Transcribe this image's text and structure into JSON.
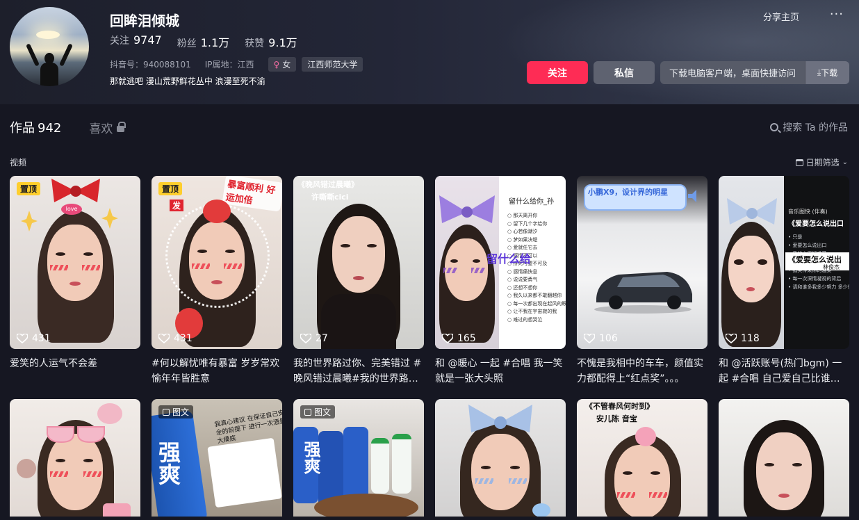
{
  "profile": {
    "name": "回眸泪倾城",
    "following_label": "关注",
    "following_value": "9747",
    "followers_label": "粉丝",
    "followers_value": "1.1万",
    "likes_label": "获赞",
    "likes_value": "9.1万",
    "douyin_id": "抖音号：940088101",
    "ip_location": "IP属地：江西",
    "gender_tag": "女",
    "school_tag": "江西师范大学",
    "bio": "那就逃吧 漫山荒野鲜花丛中 浪漫至死不渝"
  },
  "header_actions": {
    "share": "分享主页",
    "more": "···",
    "follow": "关注",
    "message": "私信",
    "download_text": "下载电脑客户端，桌面快捷访问",
    "download_button": "下载"
  },
  "tabs": {
    "works_label": "作品",
    "works_count": "942",
    "likes_label": "喜欢"
  },
  "search": {
    "label": "搜索 Ta 的作品"
  },
  "section": {
    "label": "视频",
    "date_filter": "日期筛选"
  },
  "videos_row1": [
    {
      "badge": "置顶",
      "likes": "431",
      "caption": "爱笑的人运气不会差"
    },
    {
      "badge": "置顶",
      "likes": "431",
      "caption": "#何以解忧唯有暴富 岁岁常欢愉年年皆胜意"
    },
    {
      "badge": "",
      "likes": "27",
      "caption": "我的世界路过你、完美错过 #晚风错过晨曦#我的世界路过你"
    },
    {
      "badge": "",
      "likes": "165",
      "caption": "和 @暖心 一起 #合唱 我一笑就是一张大头照"
    },
    {
      "badge": "",
      "likes": "106",
      "caption": "不愧是我相中的车车，颜值实力都配得上“红点奖”。。。"
    },
    {
      "badge": "",
      "likes": "118",
      "caption": "和 @活跃账号(热门bgm) 一起 #合唱 自己爱自己比谁爱你都重要"
    }
  ],
  "videos_row2": [
    {
      "badge": ""
    },
    {
      "badge": "图文"
    },
    {
      "badge": "图文"
    },
    {
      "badge": ""
    },
    {
      "badge": ""
    },
    {
      "badge": ""
    }
  ],
  "thumb_text": {
    "t2_sticker": "暴富顺利 好运加倍",
    "t2_fa": "发",
    "t3_title": "《晚风错过晨曦》",
    "t3_author": "许嘶嘶cici",
    "t4_title": "留什么给你_孙",
    "t4_overlay": "留什么给",
    "t4_lines": [
      "那天离开你",
      "留下几个字给你",
      "心若像潮汐",
      "梦如果决堤",
      "爱就任它去",
      "感情不可以",
      "拼死可望不可及",
      "感情痛快息",
      "说说要勇气",
      "还想不想你",
      "我久以来都不敢翻越你",
      "每一次都出现在起风的眼",
      "让不我在宇宙寂的我",
      "难过的想哭泣"
    ],
    "t5_banner": "小鹏X9，设计界的明星",
    "t6_header": "音乐图快 (伴奏)",
    "t6_title": "《爱要怎么说出口",
    "t6_song": "《爱要怎么说出",
    "t6_singer": "林俊杰",
    "t6_lines": [
      "只是",
      "爱要怎么说出口",
      "我的心里好难受",
      "第一次握你的手",
      "指尖传来你的温柔",
      "每一次深情凝视的背后",
      "请和谁多我多少努力 多少伤"
    ],
    "r2_t2_text": "我真心建议 在保证自己安全的前提下 进行一次酒量大摸底",
    "r2_t2_can": "强爽",
    "r2_t3_can": "强爽",
    "r2_t5_title": "《不管春风何时到》",
    "r2_t5_author": "安儿陈 音宝"
  },
  "colors": {
    "background": "#161722",
    "accent_red": "#fe2c55",
    "pin_yellow": "#fece2d",
    "message_gray": "#5e6270"
  }
}
